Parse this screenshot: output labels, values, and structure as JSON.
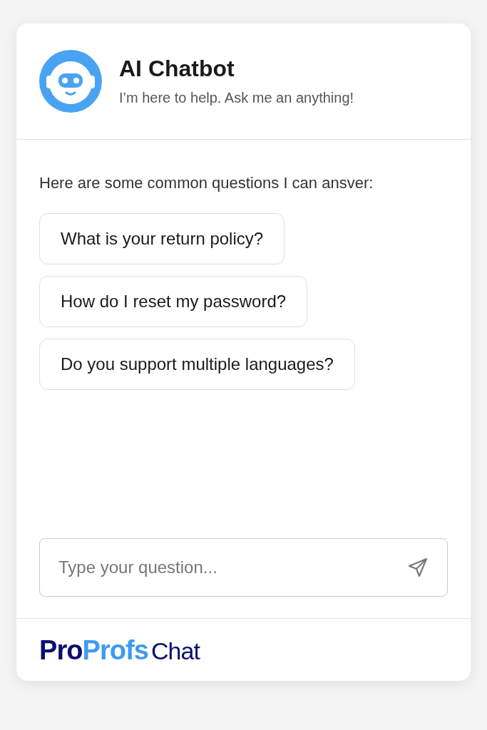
{
  "header": {
    "title": "AI Chatbot",
    "subtitle": "I’m here to help. Ask me an anything!"
  },
  "intro": "Here are some common questions I can ansver:",
  "suggestions": [
    {
      "label": "What is your return policy?"
    },
    {
      "label": "How do I reset my password?"
    },
    {
      "label": "Do you support multiple languages?"
    }
  ],
  "input": {
    "placeholder": "Type your question..."
  },
  "footer": {
    "logo": [
      {
        "text": "Pro",
        "color": "#0c0e6e",
        "bold": true
      },
      {
        "text": "Profs",
        "color": "#3d9bf0",
        "bold": true
      },
      {
        "text": "Chat",
        "color": "#0c0e6e",
        "bold": false
      }
    ]
  }
}
